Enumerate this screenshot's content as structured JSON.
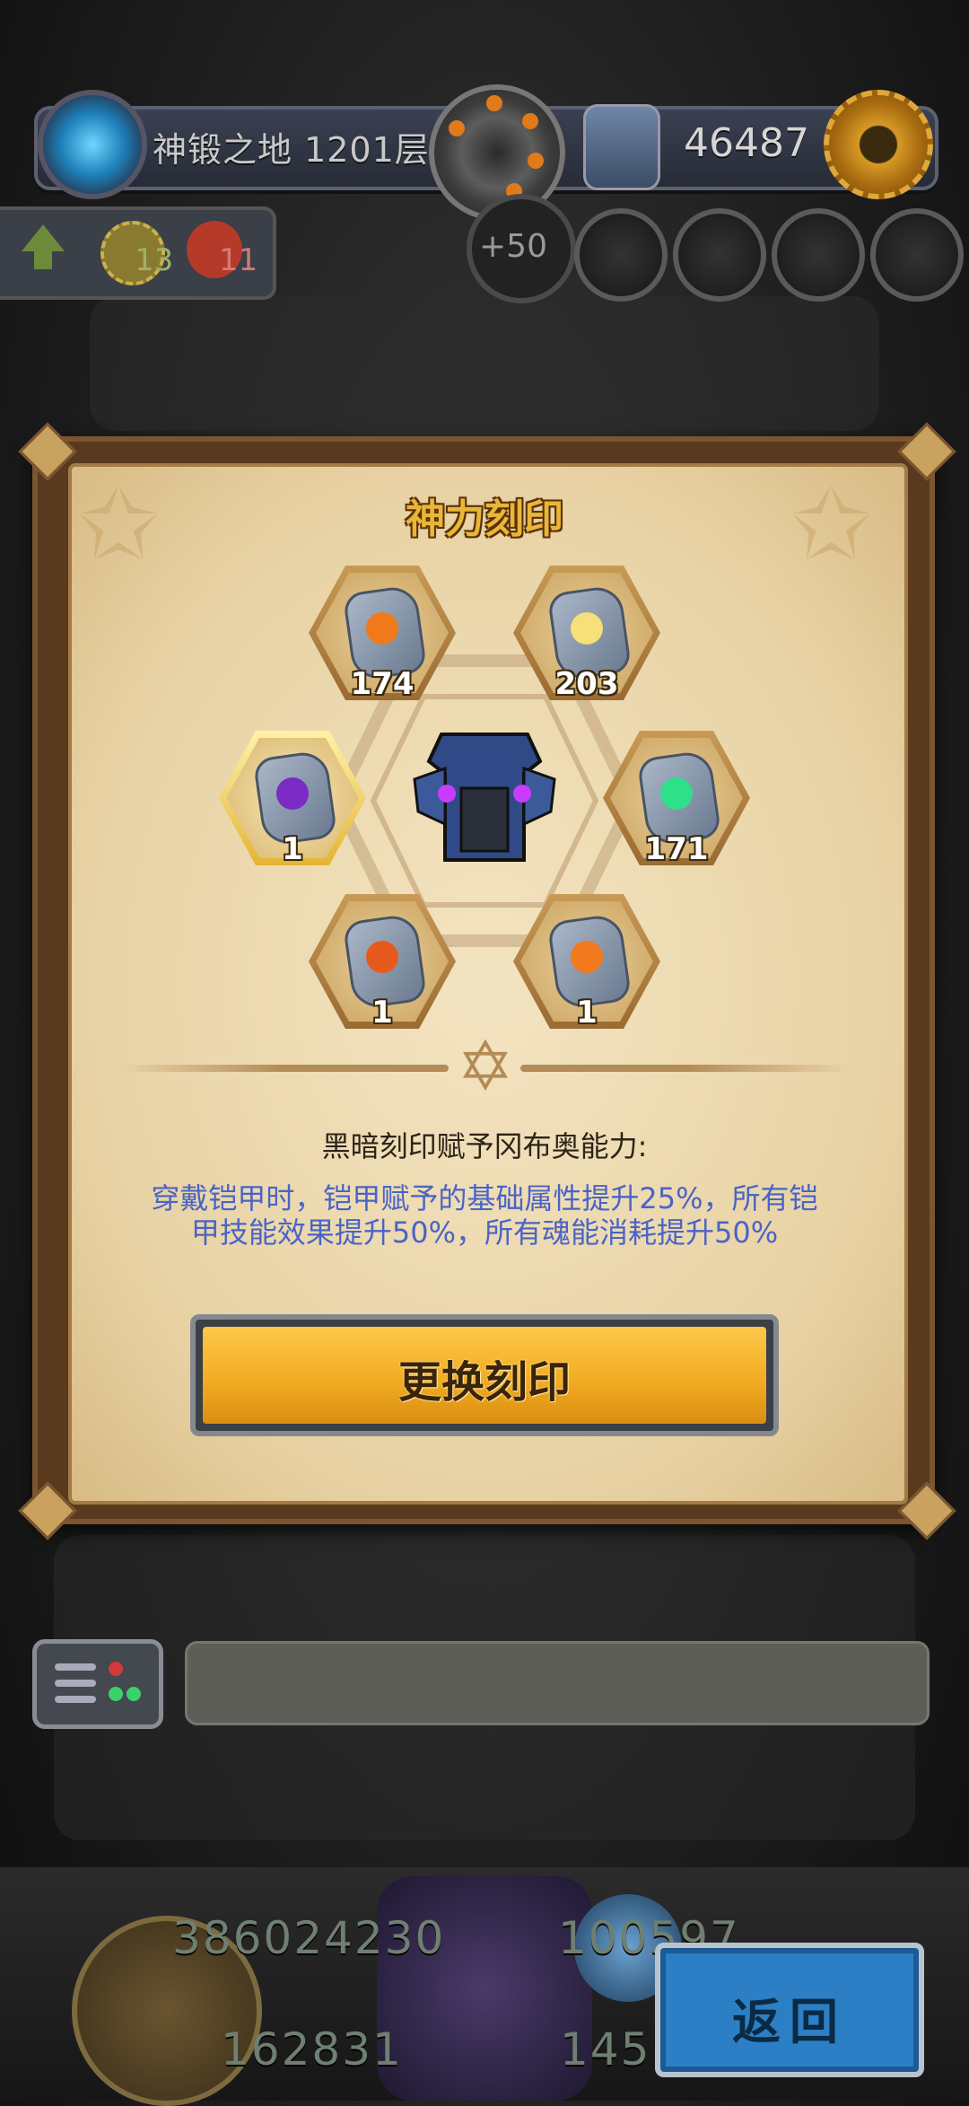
{
  "hud": {
    "floor_label": "神锻之地 1201层",
    "currency_value": "46487",
    "gear_stat": "13",
    "fire_stat": "11",
    "bonus_value": "+50"
  },
  "dialog": {
    "title": "神力刻印",
    "slots": [
      {
        "name": "rune-orange",
        "count": "174",
        "glyph_color": "#f07a1a"
      },
      {
        "name": "rune-sun",
        "count": "203",
        "glyph_color": "#f6e07a"
      },
      {
        "name": "rune-dark",
        "count": "1",
        "glyph_color": "#7a2bc4",
        "selected": true
      },
      {
        "name": "rune-green",
        "count": "171",
        "glyph_color": "#2ee08a"
      },
      {
        "name": "rune-red",
        "count": "1",
        "glyph_color": "#e65a1e"
      },
      {
        "name": "rune-fire",
        "count": "1",
        "glyph_color": "#f27a1d"
      }
    ],
    "ability_title": "黑暗刻印赋予冈布奥能力:",
    "ability_desc": "穿戴铠甲时，铠甲赋予的基础属性提升25%，所有铠甲技能效果提升50%，所有魂能消耗提升50%",
    "change_button_label": "更换刻印"
  },
  "chat": {
    "placeholder": ""
  },
  "bottom": {
    "number_1": "386024230",
    "number_2": "100597",
    "number_3": "162831",
    "number_4": "145",
    "back_button_label": "返回"
  }
}
